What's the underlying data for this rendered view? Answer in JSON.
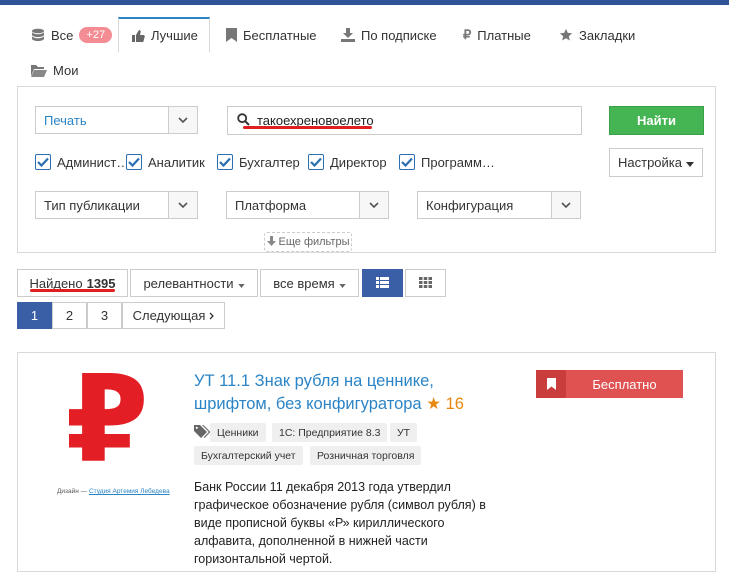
{
  "colors": {
    "accent": "#2b84c6",
    "primary_dark": "#3a5fa6",
    "success": "#45b553",
    "danger": "#e05151",
    "badge": "#f48c93",
    "rating": "#e8870f",
    "ruble_red": "#e31e24"
  },
  "tabs": [
    {
      "label": "Все",
      "icon": "database-icon",
      "badge": "+27"
    },
    {
      "label": "Лучшие",
      "icon": "thumbs-up-icon",
      "active": true
    },
    {
      "label": "Бесплатные",
      "icon": "bookmark-icon"
    },
    {
      "label": "По подписке",
      "icon": "download-icon"
    },
    {
      "label": "Платные",
      "icon": "ruble-icon"
    },
    {
      "label": "Закладки",
      "icon": "star-icon"
    },
    {
      "label": "Мои",
      "icon": "folder-open-icon"
    }
  ],
  "filters": {
    "category_select": "Печать",
    "search_value": "такоехреновоелето",
    "find_button": "Найти",
    "settings_button": "Настройка",
    "checkboxes": [
      {
        "label": "Админист…",
        "checked": true
      },
      {
        "label": "Аналитик",
        "checked": true
      },
      {
        "label": "Бухгалтер",
        "checked": true
      },
      {
        "label": "Директор",
        "checked": true
      },
      {
        "label": "Программ…",
        "checked": true
      }
    ],
    "publication_type": "Тип публикации",
    "platform": "Платформа",
    "configuration": "Конфигурация",
    "more_filters": "Еще фильтры"
  },
  "results_bar": {
    "found_label": "Найдено",
    "found_count": "1395",
    "sort_label": "релевантности",
    "period_label": "все время"
  },
  "pagination": {
    "pages": [
      "1",
      "2",
      "3"
    ],
    "current": "1",
    "next_label": "Следующая"
  },
  "result": {
    "title": "УТ 11.1 Знак рубля на ценнике, шрифтом, без конфигуратора",
    "rating": "16",
    "price_button": "Бесплатно",
    "tags": [
      "Ценники",
      "1С: Предприятие 8.3",
      "УТ",
      "Бухгалтерский учет",
      "Розничная торговля"
    ],
    "description": "Банк России 11 декабря 2013 года утвердил графическое обозначение рубля (символ рубля) в виде прописной буквы «Р» кириллического алфавита, дополненной в нижней части горизонтальной чертой.",
    "thumbnail_symbol": "₽",
    "thumbnail_caption_prefix": "Дизайн —",
    "thumbnail_caption_link": "Студия Артемия Лебедева"
  }
}
